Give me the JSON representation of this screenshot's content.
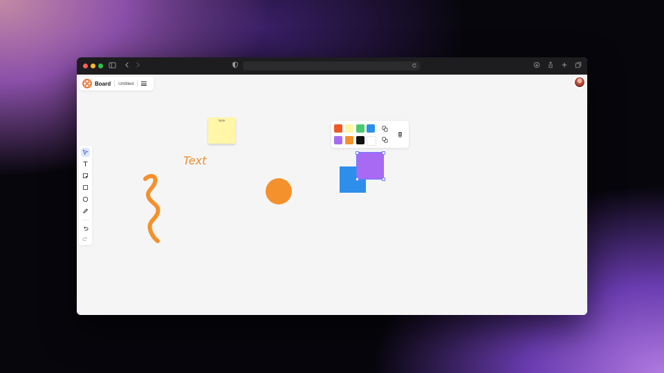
{
  "app": {
    "brand": "Board",
    "document_title": "Untitled"
  },
  "canvas_objects": {
    "note_text": "Note",
    "text_object": "Text"
  },
  "toolbar": {
    "tools": [
      "select",
      "text",
      "note",
      "rectangle",
      "ellipse",
      "pen"
    ],
    "history": [
      "undo",
      "redo"
    ]
  },
  "palette": {
    "colors": [
      "#ee5a24",
      "#fff6a8",
      "#4cc96f",
      "#2d8fea",
      "#a86af2",
      "#f5912c",
      "#111111",
      "#ffffff"
    ]
  },
  "theme": {
    "accent": "#f08a2c",
    "window_chrome": "#1d1d1f",
    "canvas_bg": "#f5f5f5"
  }
}
